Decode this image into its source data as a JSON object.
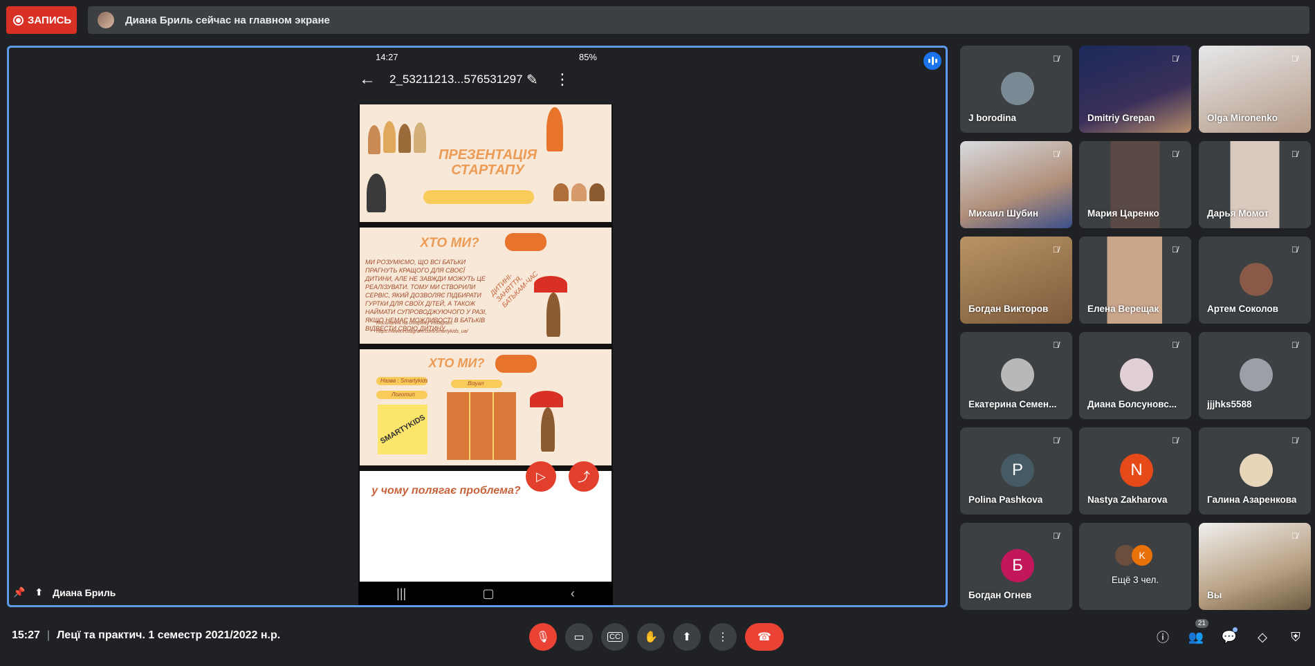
{
  "recording": {
    "label": "ЗАПИСЬ"
  },
  "banner": {
    "text": "Диана Бриль сейчас на главном экране"
  },
  "phone": {
    "time": "14:27",
    "battery": "85%",
    "file_name": "2_53211213...576531297",
    "slides": [
      {
        "title": "ПРЕЗЕНТАЦІЯ СТАРТАПУ"
      },
      {
        "title": "ХТО МИ?",
        "body": "МИ РОЗУМІЄМО, ЩО ВСІ БАТЬКИ ПРАГНУТЬ КРАЩОГО ДЛЯ СВОЄЇ ДИТИНИ, АЛЕ НЕ ЗАВЖДИ МОЖУТЬ ЦЕ РЕАЛІЗУВАТИ. ТОМУ МИ СТВОРИЛИ СЕРВІС, ЯКИЙ ДОЗВОЛЯЄ ПІДБИРАТИ ГУРТКИ ДЛЯ СВОЇХ ДІТЕЙ, А ТАКОЖ НАЙМАТИ СУПРОВОДЖУЮЧОГО У РАЗІ, ЯКЩО НЕМАЄ МОЖЛИВОСТІ В БАТЬКІВ ВІДВЕСТИ СВОЮ ДИТИНУ",
        "side": "ДИТИНІ-ЗАНЯТТЯ, БАТЬКАМ-ЧАС",
        "link_label": "Посилання на сторінку Instagram:",
        "link": "https://www.instagram.com/smartykids_ua/"
      },
      {
        "title": "ХТО МИ?",
        "name_label": "Назва : Smartykids",
        "logo_label": "Логотип",
        "visual_label": "Візуал",
        "logo_text": "SMARTYKIDS"
      },
      {
        "title": "у чому полягає проблема?"
      }
    ]
  },
  "stage_footer": {
    "presenter": "Диана Бриль"
  },
  "tiles": [
    {
      "name": "J borodina"
    },
    {
      "name": "Dmitriy Grepan"
    },
    {
      "name": "Olga Mironenko"
    },
    {
      "name": "Михаил Шубин"
    },
    {
      "name": "Мария Царенко"
    },
    {
      "name": "Дарья Момот"
    },
    {
      "name": "Богдан Викторов"
    },
    {
      "name": "Елена Верещак"
    },
    {
      "name": "Артем Соколов"
    },
    {
      "name": "Екатерина Семен..."
    },
    {
      "name": "Диана Болсуновс..."
    },
    {
      "name": "jjjhks5588"
    },
    {
      "name": "Polina Pashkova",
      "initial": "P",
      "color": "#455a64"
    },
    {
      "name": "Nastya Zakharova",
      "initial": "N",
      "color": "#e64a19"
    },
    {
      "name": "Галина Азаренкова"
    },
    {
      "name": "Богдан Огнев",
      "initial": "Б",
      "color": "#c2185b"
    },
    {
      "name": "Ещё 3 чел.",
      "initial": "K",
      "color": "#e8710a"
    },
    {
      "name": "Вы"
    }
  ],
  "bottom": {
    "time": "15:27",
    "meeting": "Лецї та практич. 1 семестр 2021/2022 н.р.",
    "participants_count": "21"
  }
}
